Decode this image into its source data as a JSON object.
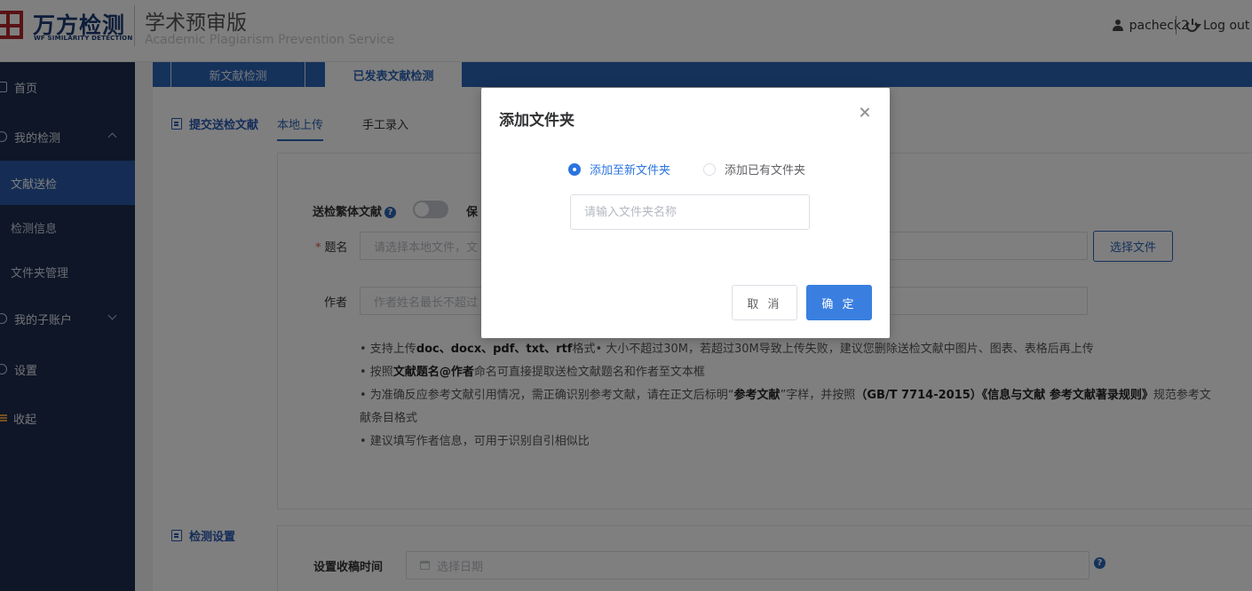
{
  "header": {
    "logo_name": "万方检测",
    "logo_sub": "WF SIMILARITY DETECTION",
    "product_title": "学术预审版",
    "product_subtitle": "Academic Plagiarism Prevention Service",
    "username": "pacheck2",
    "logout_label": "Log out"
  },
  "sidebar": {
    "items": [
      {
        "label": "首页"
      },
      {
        "label": "我的检测"
      },
      {
        "label": "文献送检"
      },
      {
        "label": "检测信息"
      },
      {
        "label": "文件夹管理"
      },
      {
        "label": "我的子账户"
      },
      {
        "label": "设置"
      },
      {
        "label": "收起"
      }
    ]
  },
  "tabs": {
    "new_label": "新文献检测",
    "published_label": "已发表文献检测"
  },
  "submit_section": {
    "title": "提交送检文献",
    "subtab_local": "本地上传",
    "subtab_manual": "手工录入",
    "traditional_label": "送检繁体文献",
    "help_glyph": "?",
    "keep_label_partial": "保",
    "title_label": "题名",
    "title_placeholder": "请选择本地文件，文",
    "choose_file_label": "选择文件",
    "author_label": "作者",
    "author_placeholder": "作者姓名最长不超过"
  },
  "notes": {
    "n1_a": "• 支持上传",
    "n1_b": "doc、docx、pdf、txt、rtf",
    "n1_c": "格式• 大小不超过30M，若超过30M导致上传失败，建议您删除送检文献中图片、图表、表格后再上传",
    "n2_a": "• 按照",
    "n2_b": "文献题名@作者",
    "n2_c": "命名可直接提取送检文献题名和作者至文本框",
    "n3_a": "• 为准确反应参考文献引用情况，需正确识别参考文献，请在正文后标明“",
    "n3_b": "参考文献",
    "n3_c": "”字样，并按照",
    "n3_d": "（GB/T 7714-2015）《信息与文献 参考文献著录规则》",
    "n3_e": "规范参考文献条目格式",
    "n4": "• 建议填写作者信息，可用于识别自引相似比"
  },
  "settings_section": {
    "title": "检测设置",
    "receive_time_label": "设置收稿时间",
    "date_placeholder": "选择日期"
  },
  "dialog": {
    "title": "添加文件夹",
    "radio_new_label": "添加至新文件夹",
    "radio_existing_label": "添加已有文件夹",
    "folder_name_placeholder": "请输入文件夹名称",
    "cancel_label": "取 消",
    "ok_label": "确 定"
  }
}
